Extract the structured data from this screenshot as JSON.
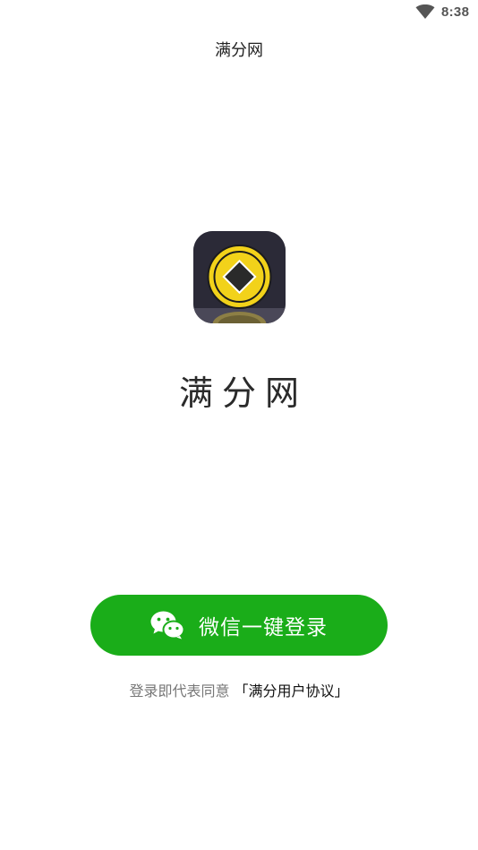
{
  "status_bar": {
    "time": "8:38",
    "wifi_icon": "wifi-icon"
  },
  "header": {
    "title": "满分网"
  },
  "app": {
    "logo_icon": "coin-logo-icon",
    "name": "满分网"
  },
  "login": {
    "wechat_button_label": "微信一键登录",
    "wechat_icon": "wechat-icon",
    "button_color": "#1aad19"
  },
  "agreement": {
    "prefix": "登录即代表同意",
    "link": "「满分用户协议」"
  }
}
